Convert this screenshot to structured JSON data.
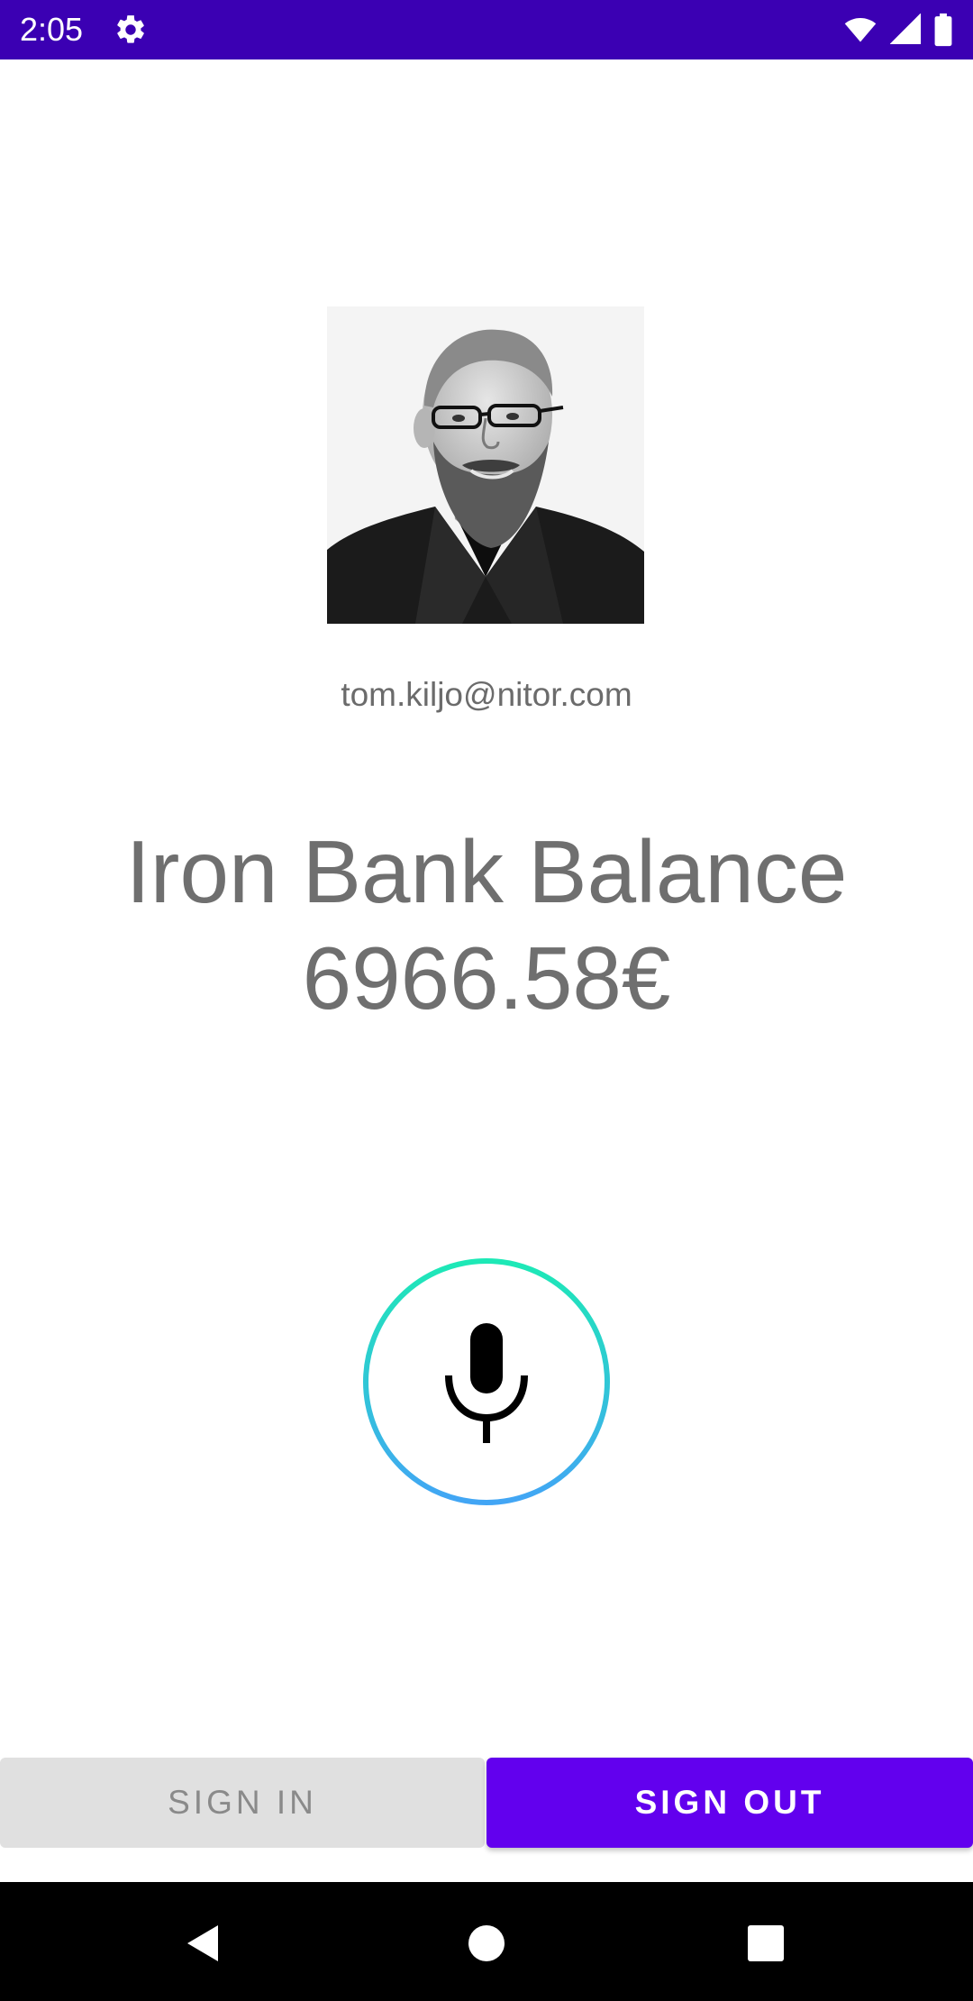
{
  "status_bar": {
    "time": "2:05",
    "settings_icon": "gear-icon",
    "wifi_icon": "wifi-icon",
    "signal_icon": "cell-signal-icon",
    "battery_icon": "battery-icon",
    "background_color": "#3b00b3"
  },
  "profile": {
    "avatar_icon": "user-photo",
    "email": "tom.kiljo@nitor.com"
  },
  "balance": {
    "label": "Iron Bank Balance",
    "value": "6966.58€"
  },
  "mic": {
    "icon": "microphone-icon",
    "ring_gradient": [
      "#1de9b6",
      "#42a5f5"
    ]
  },
  "actions": {
    "sign_in_label": "SIGN IN",
    "sign_out_label": "SIGN OUT",
    "accent_color": "#6200ee"
  },
  "nav_bar": {
    "back_icon": "back-triangle-icon",
    "home_icon": "home-circle-icon",
    "recents_icon": "recents-square-icon"
  }
}
